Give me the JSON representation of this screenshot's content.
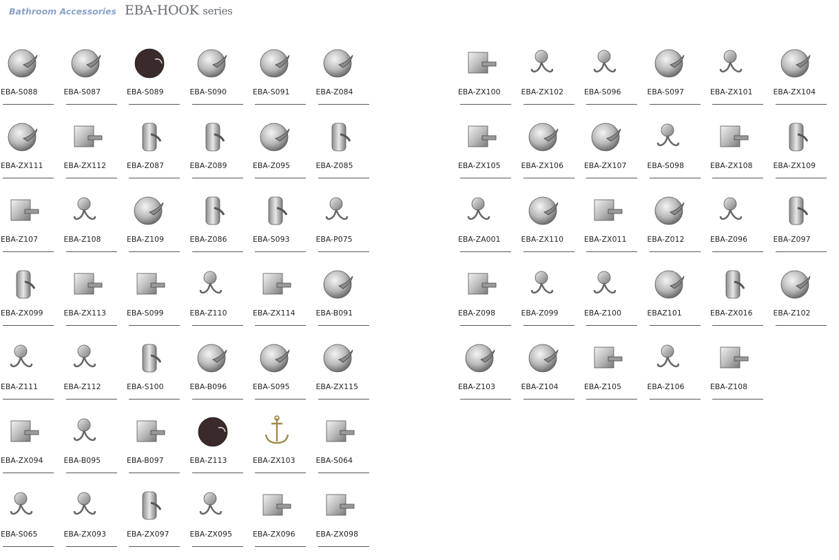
{
  "header": {
    "category": "Bathroom Accessories",
    "series_main": "EBA-HOOK",
    "series_suffix": "series"
  },
  "left_products": [
    {
      "code": "EBA-S088",
      "icon": "round-robe-hook-icon",
      "shape": "disc"
    },
    {
      "code": "EBA-S087",
      "icon": "round-robe-hook-icon",
      "shape": "disc"
    },
    {
      "code": "EBA-S089",
      "icon": "dark-round-hook-icon",
      "shape": "dark"
    },
    {
      "code": "EBA-S090",
      "icon": "round-robe-hook-icon",
      "shape": "disc"
    },
    {
      "code": "EBA-S091",
      "icon": "ornate-robe-hook-icon",
      "shape": "disc"
    },
    {
      "code": "EBA-Z084",
      "icon": "round-robe-hook-icon",
      "shape": "disc"
    },
    {
      "code": "EBA-ZX111",
      "icon": "round-robe-hook-icon",
      "shape": "disc"
    },
    {
      "code": "EBA-ZX112",
      "icon": "square-robe-hook-icon",
      "shape": "square"
    },
    {
      "code": "EBA-Z087",
      "icon": "plate-robe-hook-icon",
      "shape": "plate"
    },
    {
      "code": "EBA-Z089",
      "icon": "bar-robe-hook-icon",
      "shape": "plate"
    },
    {
      "code": "EBA-Z095",
      "icon": "round-robe-hook-icon",
      "shape": "disc"
    },
    {
      "code": "EBA-Z085",
      "icon": "bar-robe-hook-icon",
      "shape": "plate"
    },
    {
      "code": "EBA-Z107",
      "icon": "square-robe-hook-icon",
      "shape": "square"
    },
    {
      "code": "EBA-Z108",
      "icon": "double-robe-hook-icon",
      "shape": "double"
    },
    {
      "code": "EBA-Z109",
      "icon": "round-robe-hook-icon",
      "shape": "disc"
    },
    {
      "code": "EBA-Z086",
      "icon": "plate-robe-hook-icon",
      "shape": "plate"
    },
    {
      "code": "EBA-S093",
      "icon": "cylinder-robe-hook-icon",
      "shape": "plate"
    },
    {
      "code": "EBA-P075",
      "icon": "ornate-robe-hook-icon",
      "shape": "double"
    },
    {
      "code": "EBA-ZX099",
      "icon": "plate-robe-hook-icon",
      "shape": "plate"
    },
    {
      "code": "EBA-ZX113",
      "icon": "square-robe-hook-icon",
      "shape": "square"
    },
    {
      "code": "EBA-S099",
      "icon": "square-robe-hook-icon",
      "shape": "square"
    },
    {
      "code": "EBA-Z110",
      "icon": "double-robe-hook-icon",
      "shape": "double"
    },
    {
      "code": "EBA-ZX114",
      "icon": "square-robe-hook-icon",
      "shape": "square"
    },
    {
      "code": "EBA-B091",
      "icon": "round-robe-hook-icon",
      "shape": "disc"
    },
    {
      "code": "EBA-Z111",
      "icon": "wire-robe-hook-icon",
      "shape": "double"
    },
    {
      "code": "EBA-Z112",
      "icon": "wire-robe-hook-icon",
      "shape": "double"
    },
    {
      "code": "EBA-S100",
      "icon": "plate-robe-hook-icon",
      "shape": "plate"
    },
    {
      "code": "EBA-B096",
      "icon": "round-robe-hook-icon",
      "shape": "disc"
    },
    {
      "code": "EBA-S095",
      "icon": "round-robe-hook-icon",
      "shape": "disc"
    },
    {
      "code": "EBA-ZX115",
      "icon": "round-robe-hook-icon",
      "shape": "disc"
    },
    {
      "code": "EBA-ZX094",
      "icon": "square-robe-hook-icon",
      "shape": "square"
    },
    {
      "code": "EBA-B095",
      "icon": "double-robe-hook-icon",
      "shape": "double"
    },
    {
      "code": "EBA-B097",
      "icon": "square-robe-hook-icon",
      "shape": "square"
    },
    {
      "code": "EBA-Z113",
      "icon": "ornate-robe-hook-icon",
      "shape": "dark"
    },
    {
      "code": "EBA-ZX103",
      "icon": "anchor-robe-hook-icon",
      "shape": "anchor"
    },
    {
      "code": "EBA-S064",
      "icon": "square-robe-hook-icon",
      "shape": "square"
    },
    {
      "code": "EBA-S065",
      "icon": "double-robe-hook-icon",
      "shape": "double"
    },
    {
      "code": "EBA-ZX093",
      "icon": "double-robe-hook-icon",
      "shape": "double"
    },
    {
      "code": "EBA-ZX097",
      "icon": "plate-robe-hook-icon",
      "shape": "plate"
    },
    {
      "code": "EBA-ZX095",
      "icon": "double-robe-hook-icon",
      "shape": "double"
    },
    {
      "code": "EBA-ZX096",
      "icon": "square-robe-hook-icon",
      "shape": "square"
    },
    {
      "code": "EBA-ZX098",
      "icon": "square-robe-hook-icon",
      "shape": "square"
    }
  ],
  "right_products": [
    {
      "code": "EBA-ZX100",
      "icon": "bar-robe-hook-icon",
      "shape": "square"
    },
    {
      "code": "EBA-ZX102",
      "icon": "wire-robe-hook-icon",
      "shape": "double"
    },
    {
      "code": "EBA-S096",
      "icon": "double-robe-hook-icon",
      "shape": "double"
    },
    {
      "code": "EBA-S097",
      "icon": "round-robe-hook-icon",
      "shape": "disc"
    },
    {
      "code": "EBA-ZX101",
      "icon": "double-robe-hook-icon",
      "shape": "double"
    },
    {
      "code": "EBA-ZX104",
      "icon": "round-robe-hook-icon",
      "shape": "disc"
    },
    {
      "code": "EBA-ZX105",
      "icon": "square-robe-hook-icon",
      "shape": "square"
    },
    {
      "code": "EBA-ZX106",
      "icon": "round-robe-hook-icon",
      "shape": "disc"
    },
    {
      "code": "EBA-ZX107",
      "icon": "ornate-robe-hook-icon",
      "shape": "disc"
    },
    {
      "code": "EBA-S098",
      "icon": "wire-robe-hook-icon",
      "shape": "double"
    },
    {
      "code": "EBA-ZX108",
      "icon": "square-robe-hook-icon",
      "shape": "square"
    },
    {
      "code": "EBA-ZX109",
      "icon": "cone-robe-hook-icon",
      "shape": "plate"
    },
    {
      "code": "EBA-ZA001",
      "icon": "wire-robe-hook-icon",
      "shape": "double"
    },
    {
      "code": "EBA-ZX110",
      "icon": "round-robe-hook-icon",
      "shape": "disc"
    },
    {
      "code": "EBA-ZX011",
      "icon": "square-robe-hook-icon",
      "shape": "square"
    },
    {
      "code": "EBA-Z012",
      "icon": "round-robe-hook-icon",
      "shape": "disc"
    },
    {
      "code": "EBA-Z096",
      "icon": "double-robe-hook-icon",
      "shape": "double"
    },
    {
      "code": "EBA-Z097",
      "icon": "plate-robe-hook-icon",
      "shape": "plate"
    },
    {
      "code": "EBA-Z098",
      "icon": "square-robe-hook-icon",
      "shape": "square"
    },
    {
      "code": "EBA-Z099",
      "icon": "single-robe-hook-icon",
      "shape": "double"
    },
    {
      "code": "EBA-Z100",
      "icon": "double-robe-hook-icon",
      "shape": "double"
    },
    {
      "code": "EBAZ101",
      "icon": "round-robe-hook-icon",
      "shape": "disc"
    },
    {
      "code": "EBA-ZX016",
      "icon": "single-robe-hook-icon",
      "shape": "plate"
    },
    {
      "code": "EBA-Z102",
      "icon": "round-robe-hook-icon",
      "shape": "disc"
    },
    {
      "code": "EBA-Z103",
      "icon": "round-robe-hook-icon",
      "shape": "disc"
    },
    {
      "code": "EBA-Z104",
      "icon": "round-robe-hook-icon",
      "shape": "disc"
    },
    {
      "code": "EBA-Z105",
      "icon": "square-robe-hook-icon",
      "shape": "square"
    },
    {
      "code": "EBA-Z106",
      "icon": "double-robe-hook-icon",
      "shape": "double"
    },
    {
      "code": "EBA-Z108",
      "icon": "square-robe-hook-icon",
      "shape": "square"
    }
  ]
}
